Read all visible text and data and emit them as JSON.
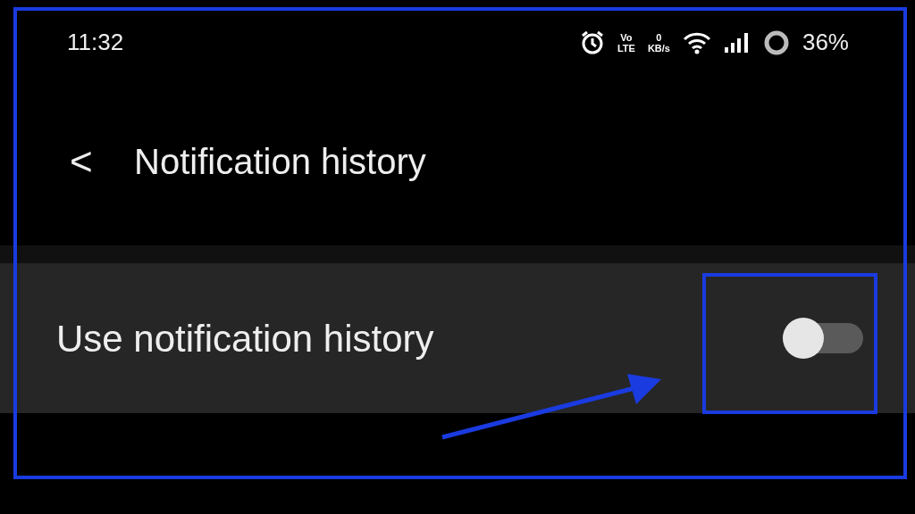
{
  "status_bar": {
    "time": "11:32",
    "volte": [
      "Vo",
      "LTE"
    ],
    "speed": [
      "0",
      "KB/s"
    ],
    "battery": "36%"
  },
  "header": {
    "back": "<",
    "title": "Notification history"
  },
  "settings": [
    {
      "kind": "toggle",
      "label": "Use notification history",
      "on": false
    }
  ]
}
